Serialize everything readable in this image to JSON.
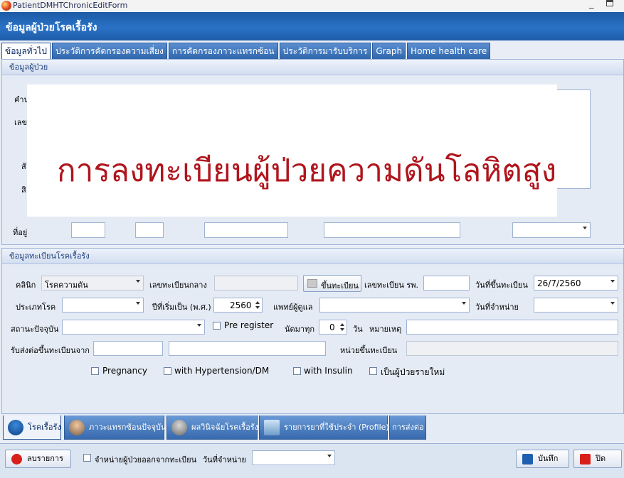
{
  "window": {
    "title": "PatientDMHTChronicEditForm",
    "minimize": "_"
  },
  "header": {
    "title": "ข้อมูลผู้ป่วยโรคเรื้อรัง"
  },
  "top_tabs": [
    {
      "label": "ข้อมูลทั่วไป",
      "active": true
    },
    {
      "label": "ประวัติการคัดกรองความเสี่ยง"
    },
    {
      "label": "การคัดกรองภาวะแทรกซ้อน"
    },
    {
      "label": "ประวัติการมารับบริการ"
    },
    {
      "label": "Graph"
    },
    {
      "label": "Home health care"
    }
  ],
  "patient_section": {
    "caption": "ข้อมูลผู้ป่วย",
    "partial_labels": [
      "คำน",
      "เลข",
      "สั",
      "สิ",
      "ที่อยู่"
    ]
  },
  "overlay": {
    "text": "การลงทะเบียนผู้ป่วยความดันโลหิตสูง"
  },
  "chronic_section": {
    "caption": "ข้อมูลทะเบียนโรคเรื้อรัง",
    "clinic_label": "คลินิก",
    "clinic_value": "โรคความดัน",
    "central_reg_label": "เลขทะเบียนกลาง",
    "register_button": "ขึ้นทะเบียน",
    "hospital_reg_label": "เลขทะเบียน รพ.",
    "reg_date_label": "วันที่ขึ้นทะเบียน",
    "reg_date_value": "26/7/2560",
    "disease_type_label": "ประเภทโรค",
    "start_year_label": "ปีที่เริ่มเป็น (พ.ศ.)",
    "start_year_value": "2560",
    "doctor_label": "แพทย์ผู้ดูแล",
    "discharge_date_label": "วันที่จำหน่าย",
    "current_status_label": "สถานะปัจจุบัน",
    "pre_register_label": "Pre register",
    "appointment_label": "นัดมาทุก",
    "appointment_value": "0",
    "day_unit": "วัน",
    "note_label": "หมายเหตุ",
    "referred_from_label": "รับส่งต่อขึ้นทะเบียนจาก",
    "reg_unit_label": "หน่วยขึ้นทะเบียน",
    "checkboxes": [
      {
        "label": "Pregnancy",
        "checked": false
      },
      {
        "label": "with Hypertension/DM",
        "checked": false
      },
      {
        "label": "with Insulin",
        "checked": false
      },
      {
        "label": "เป็นผู้ป่วยรายใหม่",
        "checked": false
      }
    ]
  },
  "bottom_tabs": [
    {
      "label": "โรคเรื้อรัง",
      "active": true,
      "icon": "person-icon"
    },
    {
      "label": "ภาวะแทรกซ้อนปัจจุบัน",
      "icon": "doctor-icon"
    },
    {
      "label": "ผลวินิจฉัยโรคเรื้อรัง",
      "icon": "patient-icon"
    },
    {
      "label": "รายการยาที่ใช้ประจำ (Profile)",
      "icon": "monitor-icon"
    },
    {
      "label": "การส่งต่อ"
    }
  ],
  "footer": {
    "delete_button": "ลบรายการ",
    "discharge_check_label": "จำหน่ายผู้ป่วยออกจากทะเบียน",
    "discharge_date_label": "วันที่จำหน่าย",
    "save_button": "บันทึก",
    "close_button": "ปิด"
  },
  "colors": {
    "header": "#2a72c6",
    "overlay_text": "#b0151d",
    "panel": "#e5ebf5"
  }
}
